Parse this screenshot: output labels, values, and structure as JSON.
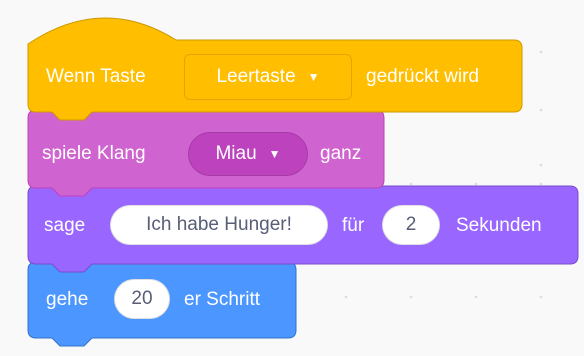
{
  "colors": {
    "events": "#ffbf00",
    "events_dark": "#e6a400",
    "sound": "#cf63cf",
    "sound_dark": "#bd42bd",
    "looks": "#9966ff",
    "motion": "#4c97ff",
    "canvas": "#f9f9f9"
  },
  "blocks": {
    "when_key": {
      "label_before": "Wenn Taste",
      "dropdown_value": "Leertaste",
      "dropdown_icon": "caret-down-icon",
      "label_after": "gedrückt wird"
    },
    "play_sound": {
      "label_before": "spiele Klang",
      "dropdown_value": "Miau",
      "dropdown_icon": "caret-down-icon",
      "label_after": "ganz"
    },
    "say_for": {
      "label_before": "sage",
      "message": "Ich habe Hunger!",
      "label_middle": "für",
      "seconds": "2",
      "label_after": "Sekunden"
    },
    "move": {
      "label_before": "gehe",
      "steps": "20",
      "label_after": "er Schritt"
    }
  }
}
